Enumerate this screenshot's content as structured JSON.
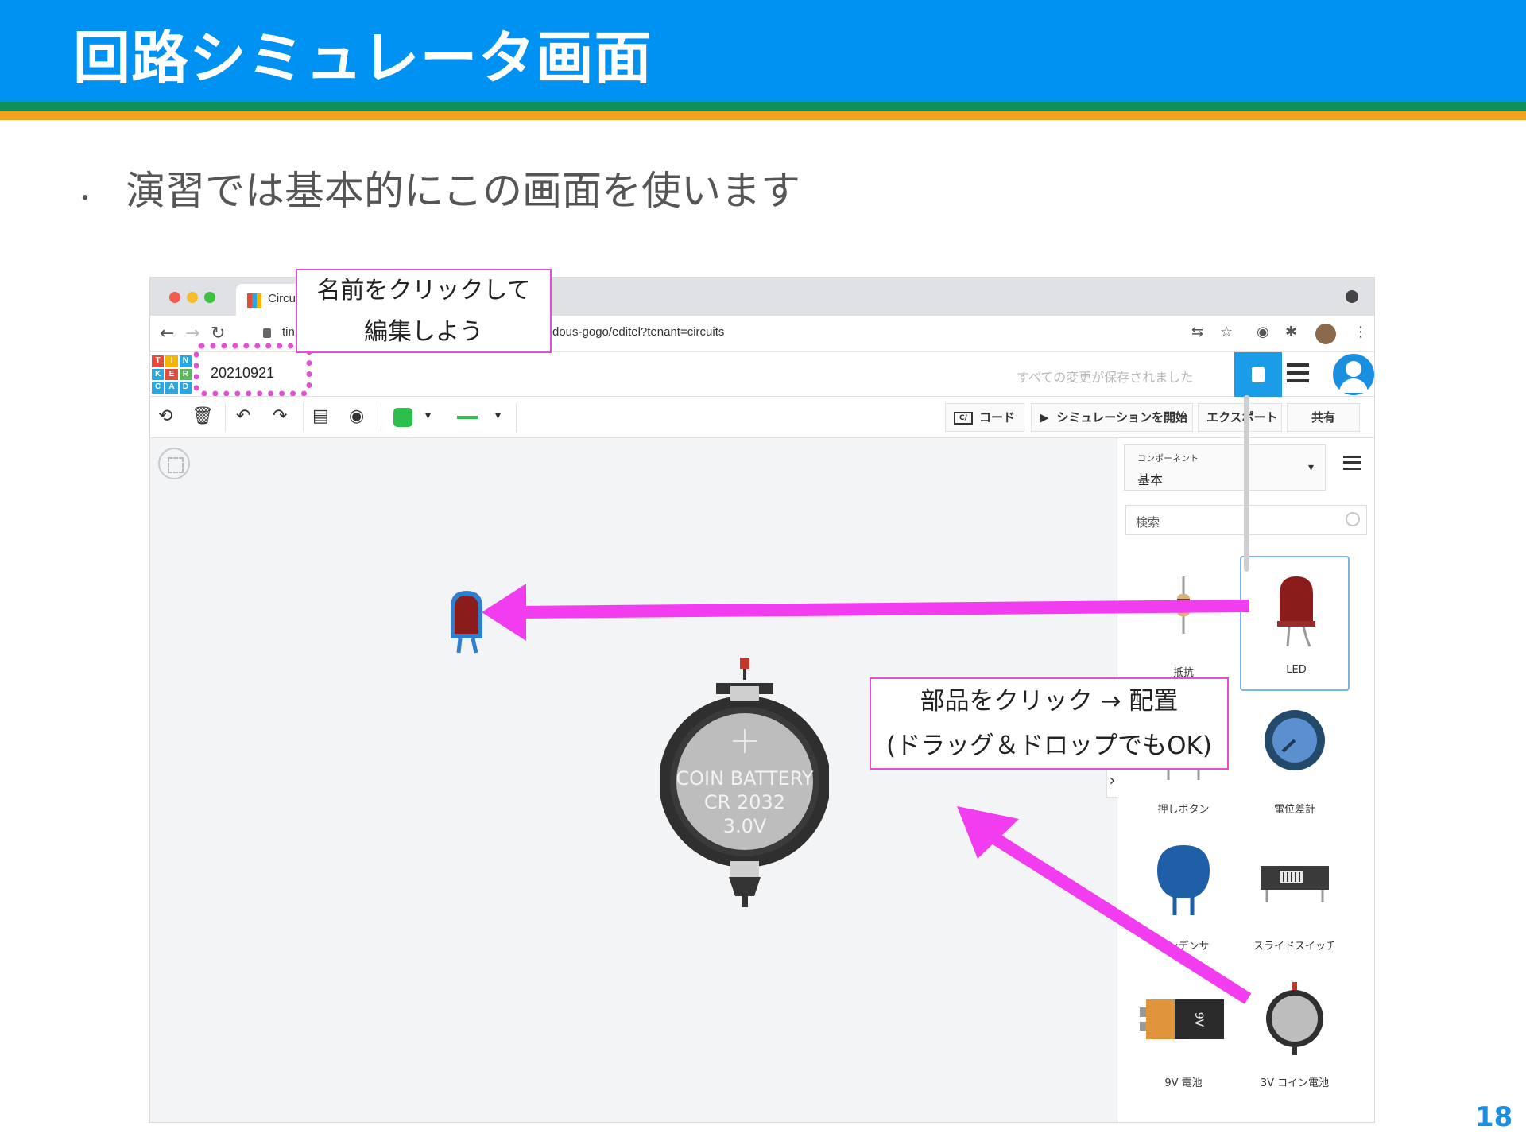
{
  "slide": {
    "title": "回路シミュレータ画面",
    "bullet": "演習では基本的にこの画面を使います",
    "bullet_marker": "・",
    "page_number": "18"
  },
  "browser": {
    "tab_title": "Circu",
    "url_host": "tin",
    "url_path": "dous-gogo/editel?tenant=circuits"
  },
  "app": {
    "logo_letters": [
      "T",
      "I",
      "N",
      "K",
      "E",
      "R",
      "C",
      "A",
      "D"
    ],
    "design_name": "20210921",
    "save_status": "すべての変更が保存されました"
  },
  "toolbar": {
    "code_icon_text": "C/",
    "code_label": "コード",
    "simulate_label": "シミュレーションを開始",
    "export_label": "エクスポート",
    "share_label": "共有"
  },
  "panel": {
    "category_label": "コンポーネント",
    "category_value": "基本",
    "search_placeholder": "検索",
    "components": [
      {
        "name": "抵抗"
      },
      {
        "name": "LED"
      },
      {
        "name": "押しボタン"
      },
      {
        "name": "電位差計"
      },
      {
        "name": "コンデンサ"
      },
      {
        "name": "スライドスイッチ"
      },
      {
        "name": "9V 電池"
      },
      {
        "name": "3V コイン電池"
      }
    ]
  },
  "canvas": {
    "battery_label_1": "COIN BATTERY",
    "battery_label_2": "CR 2032",
    "battery_label_3": "3.0V",
    "nine_volt_label": "9V"
  },
  "annotations": {
    "rename_line1": "名前をクリックして",
    "rename_line2": "編集しよう",
    "place_line1": "部品をクリック → 配置",
    "place_line2": "(ドラッグ＆ドロップでもOK)"
  },
  "colors": {
    "header_blue": "#0092f2",
    "accent_magenta": "#f23cf0",
    "annotation_border": "#e24fd3",
    "tinkercad_blue": "#1a9ce8",
    "led_red": "#8b1c1c"
  }
}
